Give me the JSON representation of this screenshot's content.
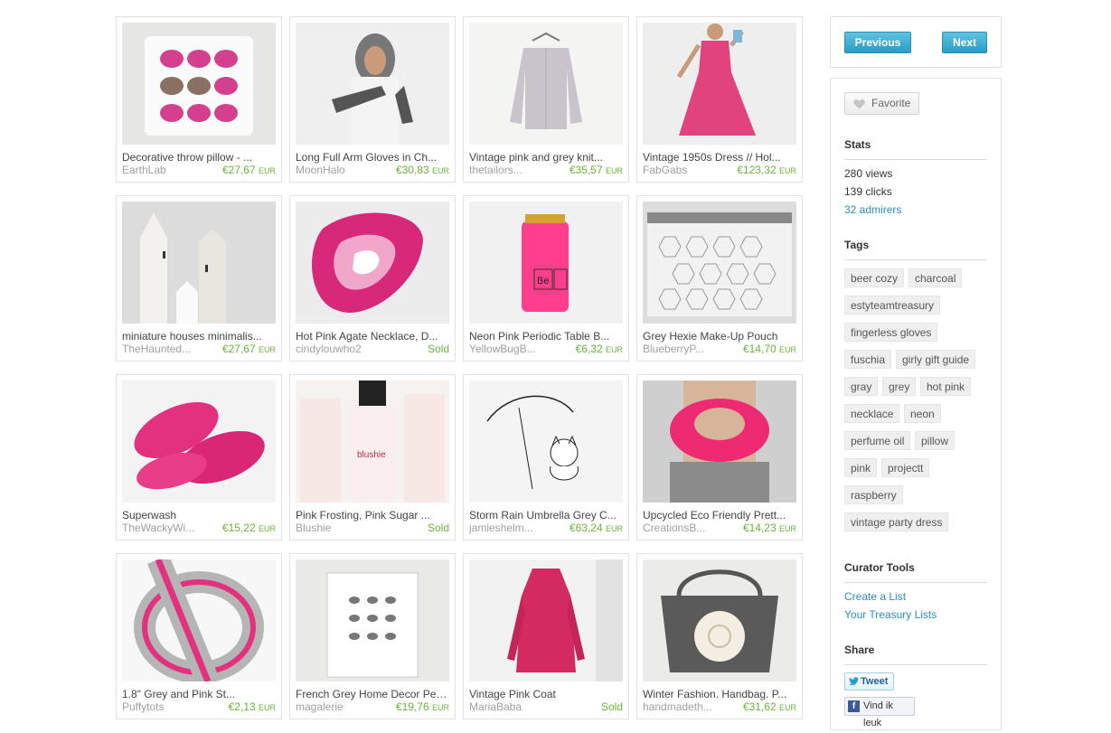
{
  "navigation": {
    "previous": "Previous",
    "next": "Next"
  },
  "listings": [
    {
      "title": "Decorative throw pillow - ...",
      "shop": "EarthLab",
      "price": "€27,67",
      "currency": "EUR",
      "sold": false,
      "image": "pillow-with-pink-hedgehogs"
    },
    {
      "title": "Long Full Arm Gloves in Ch...",
      "shop": "MoonHalo",
      "price": "€30,83",
      "currency": "EUR",
      "sold": false,
      "image": "woman-grey-hood-arm-gloves"
    },
    {
      "title": "Vintage pink and grey knit...",
      "shop": "thetailors...",
      "price": "€35,57",
      "currency": "EUR",
      "sold": false,
      "image": "grey-knit-cardigan-on-hanger"
    },
    {
      "title": "Vintage 1950s Dress // Hol...",
      "shop": "FabGabs",
      "price": "€123,32",
      "currency": "EUR",
      "sold": false,
      "image": "pink-1950s-dress"
    },
    {
      "title": "miniature houses minimalis...",
      "shop": "TheHaunted...",
      "price": "€27,67",
      "currency": "EUR",
      "sold": false,
      "image": "white-wooden-houses"
    },
    {
      "title": "Hot Pink Agate Necklace, D...",
      "shop": "cindylouwho2",
      "price": "",
      "currency": "",
      "sold": true,
      "sold_label": "Sold",
      "image": "pink-agate-slice"
    },
    {
      "title": "Neon Pink Periodic Table B...",
      "shop": "YellowBugB...",
      "price": "€6,32",
      "currency": "EUR",
      "sold": false,
      "image": "neon-pink-can-cozy"
    },
    {
      "title": "Grey Hexie Make-Up Pouch",
      "shop": "BlueberryP...",
      "price": "€14,70",
      "currency": "EUR",
      "sold": false,
      "image": "grey-hexagon-pouch"
    },
    {
      "title": "Superwash",
      "shop": "TheWackyWi...",
      "price": "€15,22",
      "currency": "EUR",
      "sold": false,
      "image": "pink-yarn-skeins"
    },
    {
      "title": "Pink Frosting, Pink Sugar ...",
      "shop": "Blushie",
      "price": "",
      "currency": "",
      "sold": true,
      "sold_label": "Sold",
      "image": "perfume-oil-bottles"
    },
    {
      "title": "Storm Rain Umbrella Grey C...",
      "shop": "jamieshelm...",
      "price": "€63,24",
      "currency": "EUR",
      "sold": false,
      "image": "cat-with-umbrella-sketch"
    },
    {
      "title": "Upcycled Eco Friendly Prett...",
      "shop": "CreationsB...",
      "price": "€14,23",
      "currency": "EUR",
      "sold": false,
      "image": "pink-infinity-scarf"
    },
    {
      "title": "1.8\" Grey and Pink St...",
      "shop": "Puffytots",
      "price": "€2,13",
      "currency": "EUR",
      "sold": false,
      "image": "grey-pink-striped-ribbon"
    },
    {
      "title": "French Grey Home Decor Peb...",
      "shop": "magalerie",
      "price": "€19,76",
      "currency": "EUR",
      "sold": false,
      "image": "framed-pebble-print"
    },
    {
      "title": "Vintage Pink Coat",
      "shop": "MariaBaba",
      "price": "",
      "currency": "",
      "sold": true,
      "sold_label": "Sold",
      "image": "pink-coat-on-mannequin"
    },
    {
      "title": "Winter Fashion. Handbag. P...",
      "shop": "handmadeth...",
      "price": "€31,62",
      "currency": "EUR",
      "sold": false,
      "image": "grey-handbag-with-doily"
    }
  ],
  "sidebar": {
    "favorite": "Favorite",
    "stats": {
      "title": "Stats",
      "views": "280 views",
      "clicks": "139 clicks",
      "admirers": "32 admirers"
    },
    "tags": {
      "title": "Tags",
      "items": [
        "beer cozy",
        "charcoal",
        "estyteamtreasury",
        "fingerless gloves",
        "fuschia",
        "girly gift guide",
        "gray",
        "grey",
        "hot pink",
        "necklace",
        "neon",
        "perfume oil",
        "pillow",
        "pink",
        "projectt",
        "raspberry",
        "vintage party dress"
      ]
    },
    "curator_tools": {
      "title": "Curator Tools",
      "create_list": "Create a List",
      "your_lists": "Your Treasury Lists"
    },
    "share": {
      "title": "Share",
      "tweet": "Tweet",
      "facebook": "Vind ik leuk"
    }
  },
  "colors": {
    "accent_blue": "#2a9cc4",
    "price_green": "#6bb33a",
    "link_blue": "#2a90c1",
    "pink": "#e8327f"
  }
}
